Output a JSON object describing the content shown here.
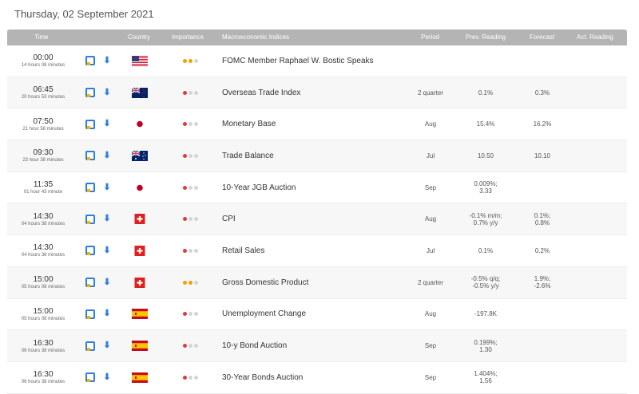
{
  "page": {
    "date": "Thursday, 02 September 2021"
  },
  "columns": {
    "time": "Time",
    "country": "Country",
    "importance": "Importance",
    "indices": "Macroeconomic Indices",
    "period": "Period",
    "prev": "Prev. Reading",
    "forecast": "Forecast",
    "actual": "Act. Reading"
  },
  "colors": {
    "header_bg": "#b4b4b4",
    "icon_blue": "#2f7de1",
    "importance_high": "#e03a3a",
    "importance_mid": "#f2a100"
  },
  "events": [
    {
      "time": "00:00",
      "countdown": "14 hours 08 minutes",
      "country": "us-flag",
      "importance": "medium",
      "event": "FOMC Member Raphael W. Bostic Speaks",
      "period": "",
      "prev": "",
      "prev2": "",
      "forecast": "",
      "forecast2": ""
    },
    {
      "time": "06:45",
      "countdown": "20 hours 53 minutes",
      "country": "nz-flag",
      "importance": "low",
      "event": "Overseas Trade Index",
      "period": "2 quarter",
      "prev": "0.1%",
      "prev2": "",
      "forecast": "0.3%",
      "forecast2": ""
    },
    {
      "time": "07:50",
      "countdown": "21 hour 58 minutes",
      "country": "jp-flag",
      "importance": "low",
      "event": "Monetary Base",
      "period": "Aug",
      "prev": "15.4%",
      "prev2": "",
      "forecast": "16.2%",
      "forecast2": ""
    },
    {
      "time": "09:30",
      "countdown": "23 hour 38 minutes",
      "country": "au-flag",
      "importance": "low",
      "event": "Trade Balance",
      "period": "Jul",
      "prev": "10.50",
      "prev2": "",
      "forecast": "10.10",
      "forecast2": ""
    },
    {
      "time": "11:35",
      "countdown": "01 hour 43 minute",
      "country": "jp-flag",
      "importance": "low",
      "event": "10-Year JGB Auction",
      "period": "Sep",
      "prev": "0.009%;",
      "prev2": "3.33",
      "forecast": "",
      "forecast2": ""
    },
    {
      "time": "14:30",
      "countdown": "04 hours 38 minutes",
      "country": "ch-flag",
      "importance": "low",
      "event": "CPI",
      "period": "Aug",
      "prev": "-0.1% m/m;",
      "prev2": "0.7% y/y",
      "forecast": "0.1%;",
      "forecast2": "0.8%"
    },
    {
      "time": "14:30",
      "countdown": "04 hours 38 minutes",
      "country": "ch-flag",
      "importance": "low",
      "event": "Retail Sales",
      "period": "Jul",
      "prev": "0.1%",
      "prev2": "",
      "forecast": "0.2%",
      "forecast2": ""
    },
    {
      "time": "15:00",
      "countdown": "05 hours 08 minutes",
      "country": "ch-flag",
      "importance": "medium",
      "event": "Gross Domestic Product",
      "period": "2 quarter",
      "prev": "-0.5% q/q;",
      "prev2": "-0.5% y/y",
      "forecast": "1.9%;",
      "forecast2": "-2.6%"
    },
    {
      "time": "15:00",
      "countdown": "05 hours 08 minutes",
      "country": "es-flag",
      "importance": "low",
      "event": "Unemployment Change",
      "period": "Aug",
      "prev": "-197.8K",
      "prev2": "",
      "forecast": "",
      "forecast2": ""
    },
    {
      "time": "16:30",
      "countdown": "06 hours 38 minutes",
      "country": "es-flag",
      "importance": "low",
      "event": "10-y Bond Auction",
      "period": "Sep",
      "prev": "0.199%;",
      "prev2": "1.30",
      "forecast": "",
      "forecast2": ""
    },
    {
      "time": "16:30",
      "countdown": "06 hours 38 minutes",
      "country": "es-flag",
      "importance": "low",
      "event": "30-Year Bonds Auction",
      "period": "Sep",
      "prev": "1.404%;",
      "prev2": "1.56",
      "forecast": "",
      "forecast2": ""
    }
  ]
}
